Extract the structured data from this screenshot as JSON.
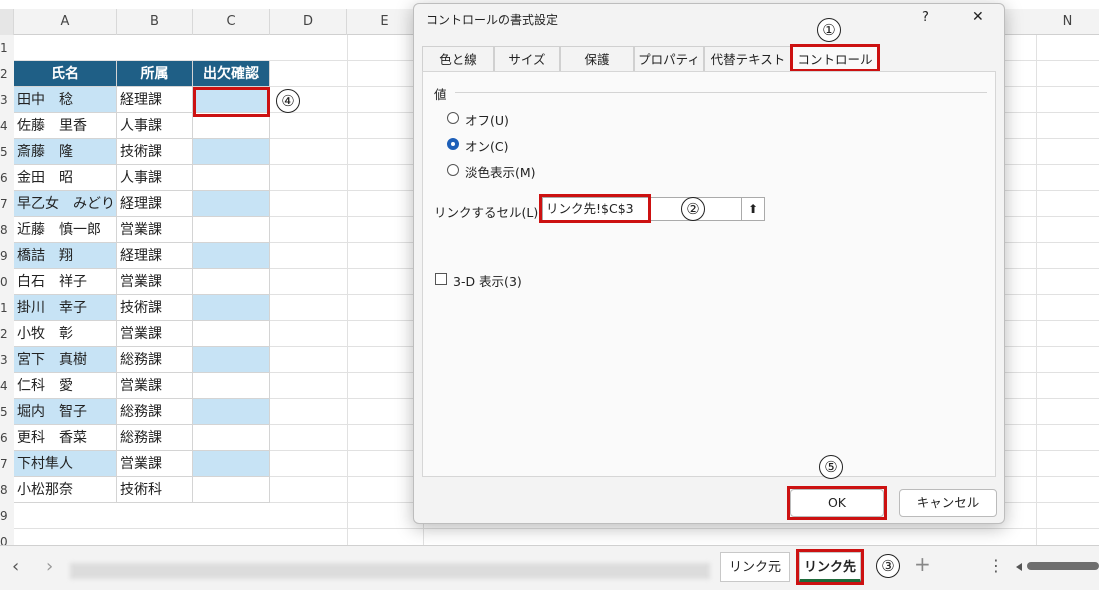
{
  "grid": {
    "columns": [
      "A",
      "B",
      "C",
      "D",
      "E",
      "N"
    ],
    "rows": [
      "1",
      "2",
      "3",
      "4",
      "5",
      "6",
      "7",
      "8",
      "9",
      "0",
      "1",
      "2",
      "3",
      "4",
      "5",
      "6",
      "7",
      "8",
      "9",
      "0"
    ],
    "header": {
      "name": "氏名",
      "dept": "所属",
      "attendance": "出欠確認"
    },
    "records": [
      {
        "name": "田中　稔",
        "dept": "経理課"
      },
      {
        "name": "佐藤　里香",
        "dept": "人事課"
      },
      {
        "name": "斎藤　隆",
        "dept": "技術課"
      },
      {
        "name": "金田　昭",
        "dept": "人事課"
      },
      {
        "name": "早乙女　みどり",
        "dept": "経理課"
      },
      {
        "name": "近藤　慎一郎",
        "dept": "営業課"
      },
      {
        "name": "橋詰　翔",
        "dept": "経理課"
      },
      {
        "name": "白石　祥子",
        "dept": "営業課"
      },
      {
        "name": "掛川　幸子",
        "dept": "技術課"
      },
      {
        "name": "小牧　彰",
        "dept": "営業課"
      },
      {
        "name": "宮下　真樹",
        "dept": "総務課"
      },
      {
        "name": "仁科　愛",
        "dept": "営業課"
      },
      {
        "name": "堀内　智子",
        "dept": "総務課"
      },
      {
        "name": "更科　香菜",
        "dept": "総務課"
      },
      {
        "name": "下村隼人",
        "dept": "営業課"
      },
      {
        "name": "小松那奈",
        "dept": "技術科"
      }
    ]
  },
  "dialog": {
    "title": "コントロールの書式設定",
    "help": "?",
    "close": "✕",
    "tabs": [
      "色と線",
      "サイズ",
      "保護",
      "プロパティ",
      "代替テキスト",
      "コントロール"
    ],
    "value_label": "値",
    "radio_off": "オフ(U)",
    "radio_on": "オン(C)",
    "radio_mixed": "淡色表示(M)",
    "link_label": "リンクするセル(L):",
    "link_value": "リンク先!$C$3",
    "ref_button": "⬆",
    "shading_3d": "3-D 表示(3)",
    "ok": "OK",
    "cancel": "キャンセル"
  },
  "sheet_tabs": {
    "nav_prev": "‹",
    "nav_next": "›",
    "tab_link_source": "リンク元",
    "tab_link_target": "リンク先",
    "add": "+",
    "more": "⋮"
  },
  "annotations": [
    "①",
    "②",
    "③",
    "④",
    "⑤"
  ],
  "colors": {
    "header": "#1f5f86",
    "band": "#c7e3f5",
    "highlight": "#cc1111",
    "radio_on": "#1d5fb8"
  }
}
